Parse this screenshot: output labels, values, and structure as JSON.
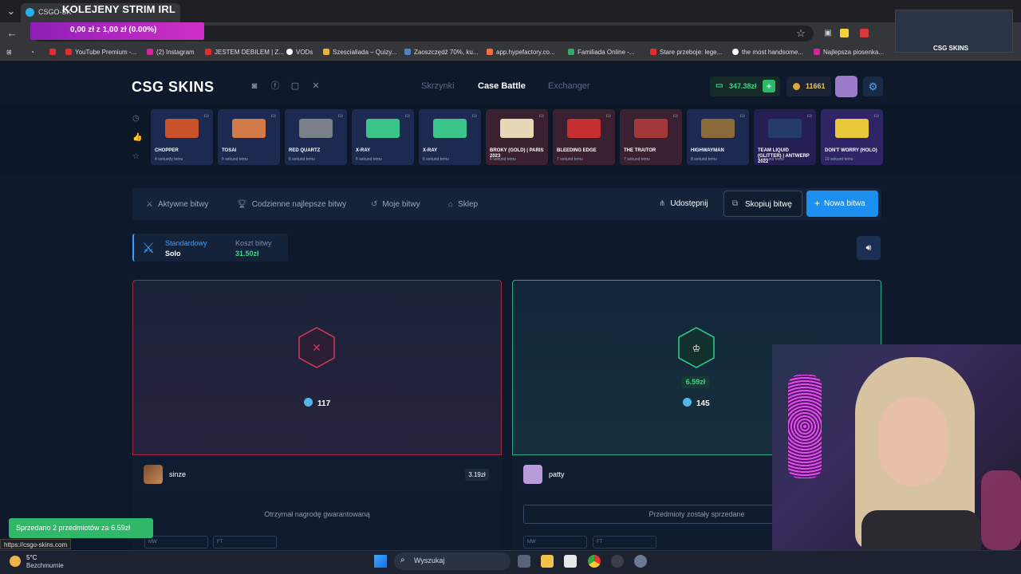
{
  "browser": {
    "tab_title": "CSGO-SK",
    "stream_title": "KOLEJENY STRIM IRL",
    "overlay_text": "0,00 zł z 1,00 zł (0.00%)",
    "bookmarks": [
      {
        "label": "YouTube Premium -...",
        "color": "#e52d27"
      },
      {
        "label": "(2) Instagram",
        "color": "#d6249f"
      },
      {
        "label": "JESTEM DEBILEM | Z...",
        "color": "#e52d27"
      },
      {
        "label": "VODs",
        "color": "#ffffff"
      },
      {
        "label": "Szescialiada – Quizy...",
        "color": "#f2b134"
      },
      {
        "label": "Zaoszczędź 70%, ku...",
        "color": "#4a86c8"
      },
      {
        "label": "app.hypefactory.co...",
        "color": "#ff6b3d"
      },
      {
        "label": "Familiada Online -...",
        "color": "#3aa86a"
      },
      {
        "label": "Stare przeboje: lege...",
        "color": "#e52d27"
      },
      {
        "label": "the most handsome...",
        "color": "#ffffff"
      },
      {
        "label": "Najlepsza piosenka...",
        "color": "#d6249f"
      }
    ],
    "thumb_logo": "CSG SKINS",
    "status_url": "https://csgo-skins.com"
  },
  "header": {
    "logo": "CSG SKINS",
    "nav": [
      {
        "label": "Skrzynki",
        "active": false
      },
      {
        "label": "Case Battle",
        "active": true
      },
      {
        "label": "Exchanger",
        "active": false
      }
    ],
    "balance": "347.38zł",
    "coins": "11661"
  },
  "drops": [
    {
      "name": "CHOPPER",
      "time": "4 sekundy temu",
      "bg": "#1c2a52",
      "art": "#c8532a"
    },
    {
      "name": "TOSAI",
      "time": "5 sekund temu",
      "bg": "#1c2a52",
      "art": "#d07a4a"
    },
    {
      "name": "RED QUARTZ",
      "time": "6 sekund temu",
      "bg": "#1c2a52",
      "art": "#7a8088"
    },
    {
      "name": "X-RAY",
      "time": "6 sekund temu",
      "bg": "#1c2a52",
      "art": "#3bc48a"
    },
    {
      "name": "X-RAY",
      "time": "6 sekund temu",
      "bg": "#1c2a52",
      "art": "#3bc48a"
    },
    {
      "name": "BROKY (GOLD) | PARIS 2023",
      "time": "6 sekund temu",
      "bg": "#3a2030",
      "art": "#e6d7b6"
    },
    {
      "name": "BLEEDING EDGE",
      "time": "7 sekund temu",
      "bg": "#3a2030",
      "art": "#c62f2f"
    },
    {
      "name": "THE TRAITOR",
      "time": "7 sekund temu",
      "bg": "#3a2030",
      "art": "#a3383a"
    },
    {
      "name": "HIGHWAYMAN",
      "time": "8 sekund temu",
      "bg": "#1c2a52",
      "art": "#8a6a3a"
    },
    {
      "name": "TEAM LIQUID (GLITTER) | ANTWERP 2022",
      "time": "9 sekund temu",
      "bg": "#241f52",
      "art": "#263c68"
    },
    {
      "name": "DON'T WORRY (HOLO)",
      "time": "10 sekund temu",
      "bg": "#2e2466",
      "art": "#e9c93a"
    }
  ],
  "battle_nav": {
    "links": [
      "Aktywne bitwy",
      "Codzienne najlepsze bitwy",
      "Moje bitwy",
      "Sklep"
    ],
    "share": "Udostępnij",
    "copy": "Skopiuj bitwę",
    "new": "Nowa bitwa"
  },
  "mode": {
    "label": "Standardowy",
    "value": "Solo",
    "cost_label": "Koszt bitwy",
    "cost_value": "31.50zł"
  },
  "players": [
    {
      "name": "sinze",
      "coins": "117",
      "value": "3.19zł",
      "result": "lose",
      "footer": "Otrzymał nagrodę gwarantowaną"
    },
    {
      "name": "patty",
      "coins": "145",
      "win_amount": "6.59zł",
      "result": "win",
      "footer": "Przedmioty zostały sprzedane"
    }
  ],
  "conditions": [
    "MW",
    "FT"
  ],
  "toast": "Sprzedano 2 przedmiotów za 6.59zł",
  "taskbar": {
    "temp": "5°C",
    "weather": "Bezchmurnie",
    "search": "Wyszukaj"
  }
}
